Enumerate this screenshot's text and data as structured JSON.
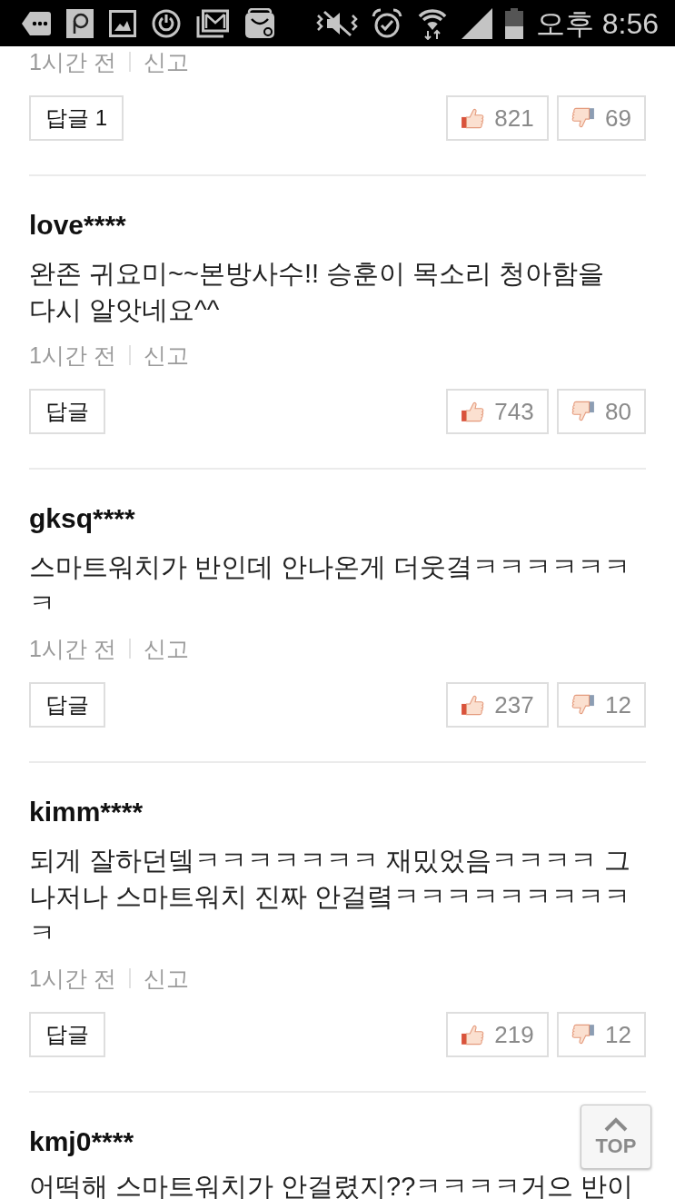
{
  "status_bar": {
    "time": "오후 8:56"
  },
  "comments": [
    {
      "time": "1시간 전",
      "report": "신고",
      "reply": "답글 1",
      "likes": "821",
      "dislikes": "69"
    },
    {
      "author": "love****",
      "text": "완존 귀요미~~본방사수!! 승훈이 목소리 청아함을 다시 알앗네요^^",
      "time": "1시간 전",
      "report": "신고",
      "reply": "답글",
      "likes": "743",
      "dislikes": "80"
    },
    {
      "author": "gksq****",
      "text": "스마트워치가 반인데 안나온게 더웃곀ㅋㅋㅋㅋㅋㅋㅋ",
      "time": "1시간 전",
      "report": "신고",
      "reply": "답글",
      "likes": "237",
      "dislikes": "12"
    },
    {
      "author": "kimm****",
      "text": "되게 잘하던뎈ㅋㅋㅋㅋㅋㅋㅋ 재밌었음ㅋㅋㅋㅋ 그나저나 스마트워치 진짜 안걸렼ㅋㅋㅋㅋㅋㅋㅋㅋㅋㅋ",
      "time": "1시간 전",
      "report": "신고",
      "reply": "답글",
      "likes": "219",
      "dislikes": "12"
    },
    {
      "author": "kmj0****",
      "text": "어떡해 스마트워치가 안걸렸지??ㅋㅋㅋㅋ거으 반이"
    }
  ],
  "top_button": {
    "label": "TOP"
  }
}
